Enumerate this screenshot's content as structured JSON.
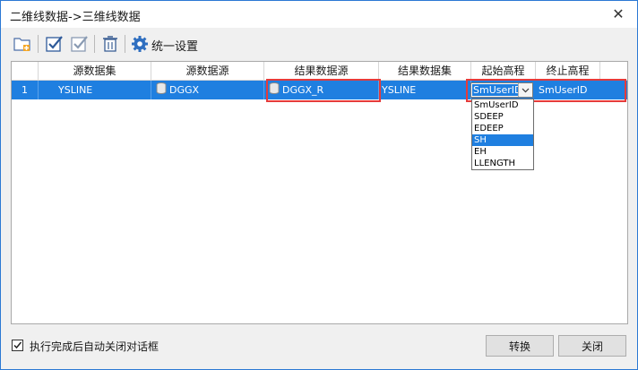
{
  "window": {
    "title": "二维线数据->三维线数据"
  },
  "toolbar": {
    "buttons": [
      {
        "icon": "folder-add-icon"
      },
      {
        "icon": "select-all-check-icon"
      },
      {
        "icon": "deselect-check-icon"
      },
      {
        "icon": "delete-icon"
      }
    ],
    "settings_label": "统一设置",
    "settings_icon": "gear-icon"
  },
  "grid": {
    "columns": [
      "",
      "源数据集",
      "源数据源",
      "结果数据源",
      "结果数据集",
      "起始高程",
      "终止高程"
    ],
    "rows": [
      {
        "index": "1",
        "source_dataset": "YSLINE",
        "source_datasource": "DGGX",
        "result_datasource": "DGGX_R",
        "result_dataset": "YSLINE",
        "start_elevation": "SmUserID",
        "end_elevation": "SmUserID"
      }
    ],
    "dropdown_options": [
      "SmUserID",
      "SDEEP",
      "EDEEP",
      "SH",
      "EH",
      "LLENGTH"
    ],
    "dropdown_selected": "SH"
  },
  "footer": {
    "auto_close_label": "执行完成后自动关闭对话框",
    "auto_close_checked": true,
    "convert_label": "转换",
    "close_label": "关闭"
  },
  "colors": {
    "selection": "#1f7fe0",
    "highlight": "#e53b3b",
    "border": "#2b78d4"
  }
}
